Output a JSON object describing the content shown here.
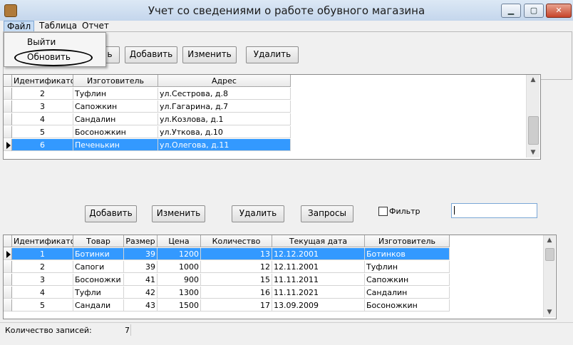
{
  "window": {
    "title": "Учет со сведениями о работе обувного магазина"
  },
  "menubar": {
    "file": "Файл",
    "table": "Таблица",
    "report": "Отчет"
  },
  "file_menu": {
    "exit": "Выйти",
    "refresh": "Обновить"
  },
  "top_toolbar": {
    "partial": "ь",
    "add": "Добавить",
    "edit": "Изменить",
    "delete": "Удалить"
  },
  "manufacturers_grid": {
    "headers": [
      "Идентификатор",
      "Изготовитель",
      "Адрес"
    ],
    "rows": [
      [
        "2",
        "Туфлин",
        "ул.Сестрова, д.8"
      ],
      [
        "3",
        "Сапожкин",
        "ул.Гагарина, д.7"
      ],
      [
        "4",
        "Сандалин",
        "ул.Козлова, д.1"
      ],
      [
        "5",
        "Босоножкин",
        "ул.Уткова, д.10"
      ],
      [
        "6",
        "Печенькин",
        "ул.Олегова, д.11"
      ]
    ],
    "selected_row": 4
  },
  "middle_toolbar": {
    "add": "Добавить",
    "edit": "Изменить",
    "delete": "Удалить",
    "queries": "Запросы",
    "filter_label": "Фильтр",
    "filter_value": ""
  },
  "products_grid": {
    "headers": [
      "Идентификатор",
      "Товар",
      "Размер",
      "Цена",
      "Количество",
      "Текущая дата",
      "Изготовитель"
    ],
    "rows": [
      [
        "1",
        "Ботинки",
        "39",
        "1200",
        "13",
        "12.12.2001",
        "Ботинков"
      ],
      [
        "2",
        "Сапоги",
        "39",
        "1000",
        "12",
        "12.11.2001",
        "Туфлин"
      ],
      [
        "3",
        "Босоножки",
        "41",
        "900",
        "15",
        "11.11.2011",
        "Сапожкин"
      ],
      [
        "4",
        "Туфли",
        "42",
        "1300",
        "16",
        "11.11.2021",
        "Сандалин"
      ],
      [
        "5",
        "Сандали",
        "43",
        "1500",
        "17",
        "13.09.2009",
        "Босоножкин"
      ]
    ],
    "selected_row": 0
  },
  "status": {
    "label": "Количество записей:",
    "count": "7"
  },
  "icons": {
    "minimize": "minimize-icon",
    "maximize": "maximize-icon",
    "close": "close-icon",
    "row_pointer": "triangle-right-icon",
    "scroll_up": "chevron-up-icon",
    "scroll_down": "chevron-down-icon"
  }
}
